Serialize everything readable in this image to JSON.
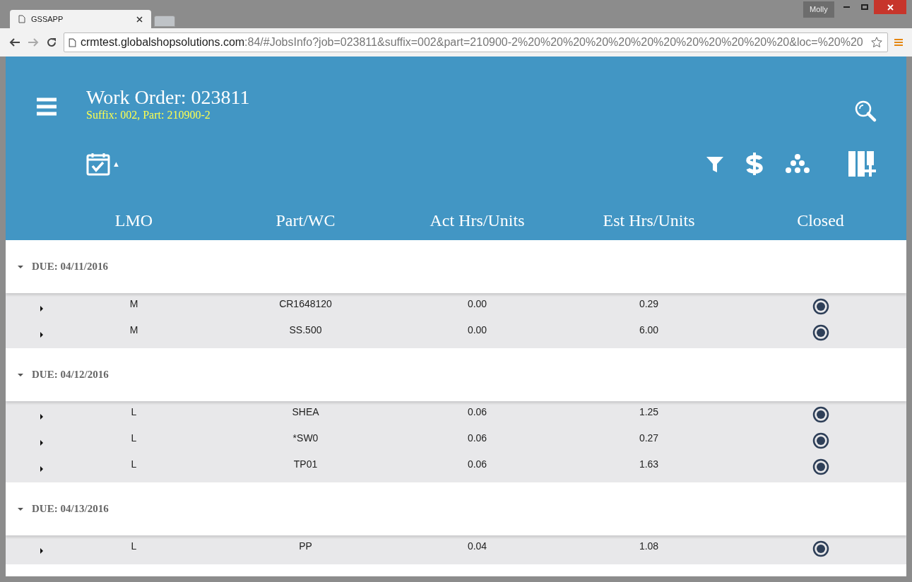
{
  "browser": {
    "user": "Molly",
    "tab_title": "GSSAPP",
    "url_host": "crmtest.globalshopsolutions.com",
    "url_rest": ":84/#JobsInfo?job=023811&suffix=002&part=210900-2%20%20%20%20%20%20%20%20%20%20%20%20&loc=%20%20"
  },
  "header": {
    "title": "Work Order: 023811",
    "subtitle": "Suffix: 002, Part: 210900-2",
    "sort_caret": "▲"
  },
  "columns": [
    "LMO",
    "Part/WC",
    "Act Hrs/Units",
    "Est Hrs/Units",
    "Closed"
  ],
  "groups": [
    {
      "label": "DUE: 04/11/2016",
      "expanded": true,
      "rows": [
        {
          "lmo": "M",
          "part": "CR1648120",
          "act": "0.00",
          "est": "0.29",
          "closed": true,
          "expanded": false
        },
        {
          "lmo": "M",
          "part": "SS.500",
          "act": "0.00",
          "est": "6.00",
          "closed": true,
          "expanded": false
        }
      ]
    },
    {
      "label": "DUE: 04/12/2016",
      "expanded": true,
      "rows": [
        {
          "lmo": "L",
          "part": "SHEA",
          "act": "0.06",
          "est": "1.25",
          "closed": true,
          "expanded": false
        },
        {
          "lmo": "L",
          "part": "*SW0",
          "act": "0.06",
          "est": "0.27",
          "closed": true,
          "expanded": false
        },
        {
          "lmo": "L",
          "part": "TP01",
          "act": "0.06",
          "est": "1.63",
          "closed": true,
          "expanded": false
        }
      ]
    },
    {
      "label": "DUE: 04/13/2016",
      "expanded": true,
      "rows": [
        {
          "lmo": "L",
          "part": "PP",
          "act": "0.04",
          "est": "1.08",
          "closed": true,
          "expanded": false
        }
      ]
    }
  ]
}
